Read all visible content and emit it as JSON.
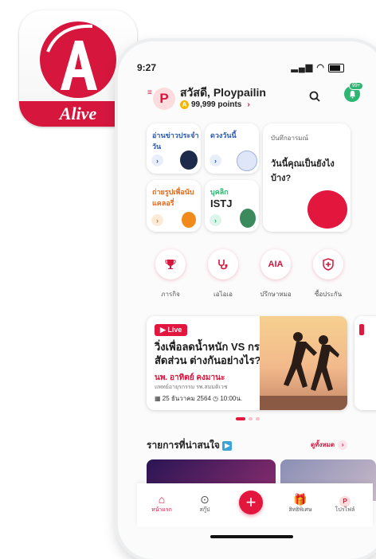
{
  "app_icon": {
    "letter": "A",
    "name": "Alive"
  },
  "status": {
    "time": "9:27"
  },
  "header": {
    "greeting": "สวัสดี, Ploypailin",
    "avatar_letter": "P",
    "points": "99,999 points",
    "badge": "99+"
  },
  "cards": {
    "news": "อ่านข่าวประจำวัน",
    "horoscope": "ดวงวันนี้",
    "mood_title": "บันทึกอารมณ์",
    "mood_question": "วันนี้คุณเป็นยังไงบ้าง?",
    "calorie": "ถ่ายรูปเพื่อนับแคลอรี่",
    "personality_label": "บุคลิก",
    "personality_value": "ISTJ"
  },
  "quick_actions": [
    "ภารกิจ",
    "เอไอเอ",
    "ปรึกษาหมอ",
    "ซื้อประกัน"
  ],
  "aia_label": "AIA",
  "banner": {
    "live": "Live",
    "title": "วิ่งเพื่อลดน้ำหนัก VS กระชับสัดส่วน ต่างกันอย่างไร?",
    "doctor": "นพ. อาทิตย์ คงมานะ",
    "doctor_sub": "แพทย์อายุรกรรม รพ.สมมติเวช",
    "date": "25 ธันวาคม 2564",
    "time": "10:00น."
  },
  "section": {
    "title": "รายการที่น่าสนใจ",
    "see_all": "ดูทั้งหมด"
  },
  "tabs": [
    "หน้าแรก",
    "สกู๊ป",
    "สิทธิพิเศษ",
    "โปรไฟล์"
  ],
  "profile_tab_letter": "P",
  "colors": {
    "brand": "#d6163d",
    "accent_blue": "#2b58b0",
    "green": "#2fb673"
  },
  "icons": [
    "search-icon",
    "bell-icon",
    "trophy-icon",
    "stethoscope-icon",
    "shield-icon",
    "home-icon",
    "play-icon",
    "gift-icon",
    "plus-icon",
    "calendar-icon",
    "clock-icon"
  ]
}
